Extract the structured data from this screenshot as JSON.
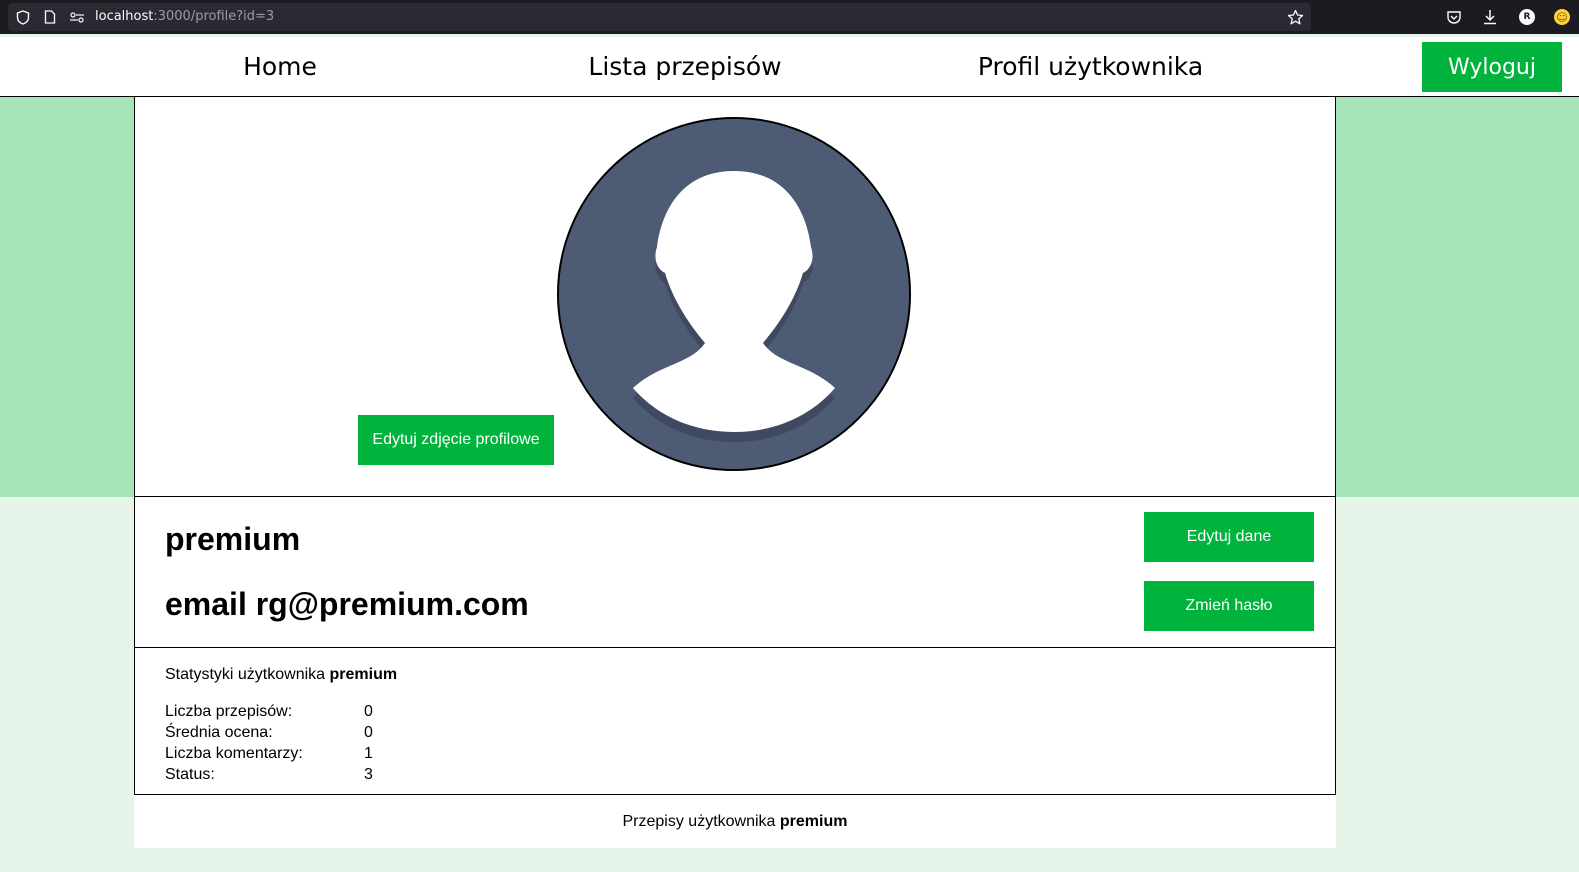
{
  "browser": {
    "url_host": "localhost",
    "url_path": ":3000/profile?id=3",
    "profile_initial": "R"
  },
  "nav": {
    "home": "Home",
    "recipes": "Lista przepisów",
    "profile": "Profil użytkownika",
    "logout": "Wyloguj"
  },
  "profile": {
    "edit_photo": "Edytuj zdjęcie profilowe",
    "username": "premium",
    "email_label": "email",
    "email": "rg@premium.com",
    "edit_data": "Edytuj dane",
    "change_password": "Zmień hasło"
  },
  "stats": {
    "title_prefix": "Statystyki użytkownika",
    "title_user": "premium",
    "rows": [
      {
        "label": "Liczba przepisów:",
        "value": "0"
      },
      {
        "label": "Średnia ocena:",
        "value": "0"
      },
      {
        "label": "Liczba komentarzy:",
        "value": "1"
      },
      {
        "label": "Status:",
        "value": "3"
      }
    ]
  },
  "recipes": {
    "prefix": "Przepisy użytkownika",
    "user": "premium"
  },
  "colors": {
    "accent": "#00b33c",
    "band": "#a5e5b9",
    "page_bg": "#e6f4ea",
    "avatar_bg": "#4d5b75"
  }
}
